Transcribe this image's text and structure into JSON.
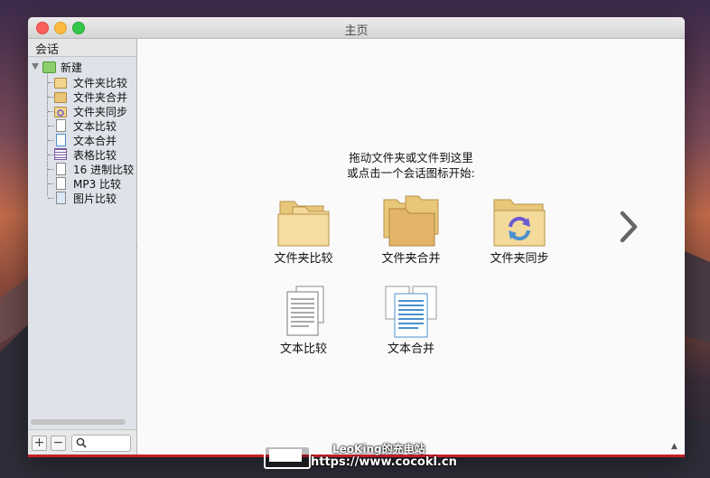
{
  "window": {
    "title": "主页"
  },
  "sidebar": {
    "header": "会话",
    "root": {
      "label": "新建",
      "icon": "new-session-icon"
    },
    "items": [
      {
        "label": "文件夹比较",
        "icon": "folder-compare-icon"
      },
      {
        "label": "文件夹合并",
        "icon": "folder-merge-icon"
      },
      {
        "label": "文件夹同步",
        "icon": "folder-sync-icon"
      },
      {
        "label": "文本比较",
        "icon": "text-compare-icon"
      },
      {
        "label": "文本合并",
        "icon": "text-merge-icon"
      },
      {
        "label": "表格比较",
        "icon": "table-compare-icon"
      },
      {
        "label": "16 进制比较",
        "icon": "hex-compare-icon"
      },
      {
        "label": "MP3 比较",
        "icon": "mp3-compare-icon"
      },
      {
        "label": "图片比较",
        "icon": "picture-compare-icon"
      }
    ],
    "add_label": "+",
    "remove_label": "−"
  },
  "main": {
    "prompt_line1": "拖动文件夹或文件到这里",
    "prompt_line2": "或点击一个会话图标开始:",
    "actions": [
      {
        "label": "文件夹比较",
        "icon": "folder-compare-icon"
      },
      {
        "label": "文件夹合并",
        "icon": "folder-merge-icon"
      },
      {
        "label": "文件夹同步",
        "icon": "folder-sync-icon"
      },
      {
        "label": "文本比较",
        "icon": "text-compare-icon"
      },
      {
        "label": "文本合并",
        "icon": "text-merge-icon"
      }
    ],
    "next_icon": "chevron-right-icon"
  },
  "watermark": {
    "line1": "LeoKing的充电站",
    "line2": "https://www.cocokl.cn"
  },
  "colors": {
    "folder": "#f3d58e",
    "sync_arrows": "#6a5ad0",
    "text_doc_blue": "#4a90d0",
    "accent_red": "#c8202a"
  }
}
